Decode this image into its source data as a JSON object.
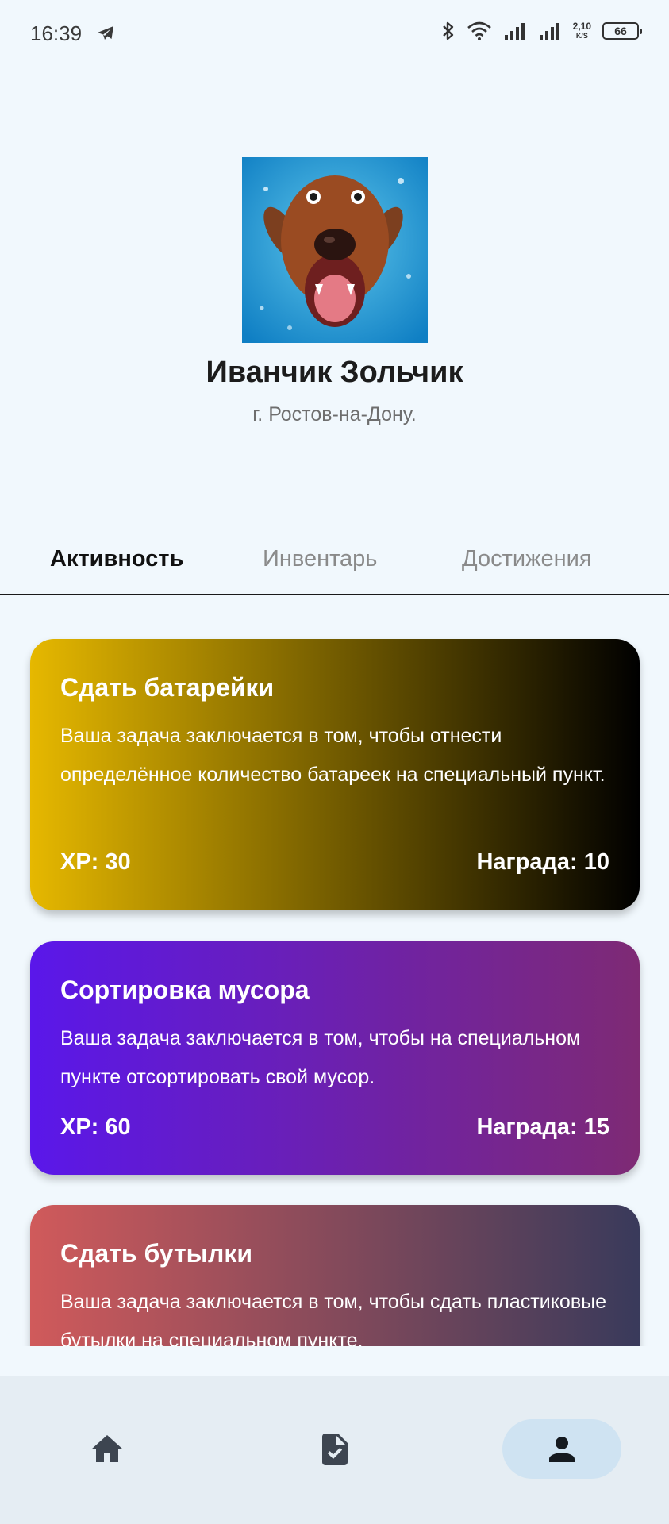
{
  "status_bar": {
    "time": "16:39",
    "net_speed_value": "2,10",
    "net_speed_unit": "K/S",
    "battery": "66"
  },
  "profile": {
    "name": "Иванчик Зольчик",
    "city": "г. Ростов-на-Дону."
  },
  "tabs": [
    {
      "label": "Активность",
      "active": true
    },
    {
      "label": "Инвентарь",
      "active": false
    },
    {
      "label": "Достижения",
      "active": false
    }
  ],
  "tasks": [
    {
      "title": "Сдать батарейки",
      "description": "Ваша задача заключается в том, чтобы отнести определённое количество батареек на специальный пункт.",
      "xp": "XP: 30",
      "reward": "Награда: 10",
      "gradient": [
        "#e6b800",
        "#000000"
      ]
    },
    {
      "title": "Сортировка мусора",
      "description": "Ваша задача заключается в том, чтобы на специальном пункте отсортировать свой мусор.",
      "xp": "XP: 60",
      "reward": "Награда: 15",
      "gradient": [
        "#5a17ea",
        "#7e2a74"
      ]
    },
    {
      "title": "Сдать бутылки",
      "description": "Ваша задача заключается в том, чтобы сдать пластиковые бутылки на специальном пункте.",
      "xp": "",
      "reward": "",
      "gradient": [
        "#d05a5b",
        "#393a5b"
      ]
    }
  ],
  "bottom_nav": [
    {
      "icon": "home-icon",
      "active": false
    },
    {
      "icon": "task-document-icon",
      "active": false
    },
    {
      "icon": "person-icon",
      "active": true
    }
  ],
  "colors": {
    "background": "#f1f8fd",
    "nav_background": "#e5edf3",
    "nav_active_pill": "#cfe3f2"
  }
}
